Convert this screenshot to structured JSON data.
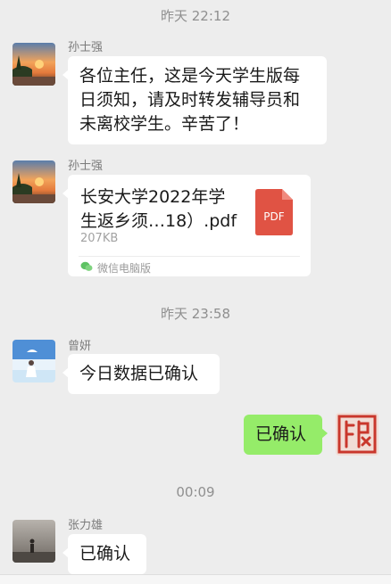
{
  "messages": {
    "ts1": "昨天 22:12",
    "msg1": {
      "sender": "孙士强",
      "text": "各位主任，这是今天学生版每日须知，请及时转发辅导员和未离校学生。辛苦了！"
    },
    "msg2": {
      "sender": "孙士强",
      "file_name": "长安大学2022年学生返乡须…18）.pdf",
      "file_size": "207KB",
      "file_badge": "PDF",
      "source": "微信电脑版"
    },
    "ts2": "昨天 23:58",
    "msg3": {
      "sender": "曾妍",
      "text": "今日数据已确认"
    },
    "msg4": {
      "text": "已确认"
    },
    "ts3": "00:09",
    "msg5": {
      "sender": "张力雄",
      "text": "已确认"
    }
  },
  "colors": {
    "background": "#ededed",
    "bubble_incoming": "#ffffff",
    "bubble_outgoing": "#95ec69",
    "pdf_red": "#e05344"
  },
  "icons": {
    "pdf": "pdf-file-icon",
    "source": "wechat-pc-icon"
  }
}
